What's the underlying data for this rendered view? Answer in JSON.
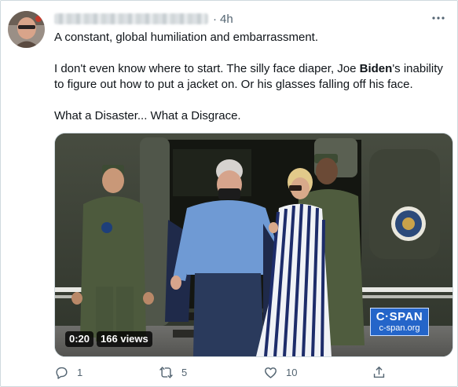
{
  "tweet": {
    "author_name_redacted": true,
    "separator": "·",
    "timestamp": "4h",
    "paragraphs": {
      "p1": "A constant, global humiliation and embarrassment.",
      "p2_before": "I don't even know where to start. The silly face diaper, Joe ",
      "p2_bold": "Biden",
      "p2_after": "'s inability to figure out how to put a jacket on. Or his glasses falling off his face.",
      "p3": "What a Disaster... What a Disgrace."
    },
    "video": {
      "duration": "0:20",
      "views": "166 views",
      "watermark_title": "C·SPAN",
      "watermark_url": "c-span.org"
    },
    "actions": {
      "reply_count": "1",
      "retweet_count": "5",
      "like_count": "10"
    }
  },
  "colors": {
    "text": "#0f1419",
    "muted": "#536471",
    "border": "#cfd9de",
    "cspan_blue": "#2465c9"
  },
  "icons": [
    "more-icon",
    "reply-icon",
    "retweet-icon",
    "like-icon",
    "share-icon"
  ]
}
